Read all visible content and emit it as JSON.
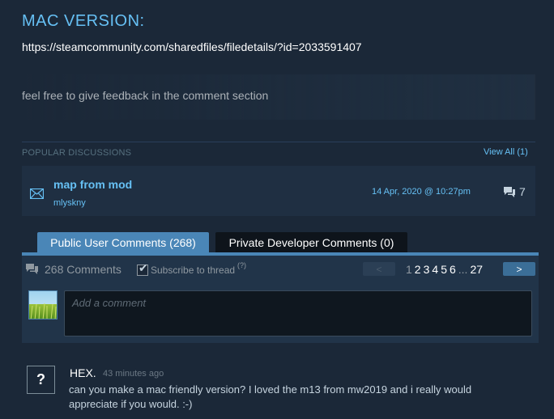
{
  "description": {
    "heading": "MAC VERSION:",
    "link": "https://steamcommunity.com/sharedfiles/filedetails/?id=2033591407",
    "feedback": "feel free to give feedback in the comment section"
  },
  "discussions": {
    "header": "POPULAR DISCUSSIONS",
    "view_all": "View All (1)",
    "items": [
      {
        "title": "map from mod",
        "author": "mlyskny",
        "date": "14 Apr, 2020 @ 10:27pm",
        "replies": "7",
        "icon": "envelope-icon"
      }
    ]
  },
  "tabs": {
    "public": "Public User Comments (268)",
    "private": "Private Developer Comments (0)"
  },
  "comments_bar": {
    "count": "268 Comments",
    "subscribe_label": "Subscribe to thread",
    "subscribe_checked": true,
    "help": "(?)",
    "prev": "<",
    "next": ">",
    "pages": [
      "1",
      "2",
      "3",
      "4",
      "5",
      "6",
      "...",
      "27"
    ],
    "current_page": "1"
  },
  "add_comment": {
    "placeholder": "Add a comment"
  },
  "comments": [
    {
      "author": "HEX.",
      "time": "43 minutes ago",
      "avatar_glyph": "?",
      "text": "can you make a mac friendly version? I loved the m13 from mw2019 and i really would appreciate if you would. :-)"
    }
  ],
  "colors": {
    "background": "#1b2838",
    "accent": "#66c0f4",
    "tab_active": "#4a86b7",
    "tab_inactive": "#0e141b"
  }
}
